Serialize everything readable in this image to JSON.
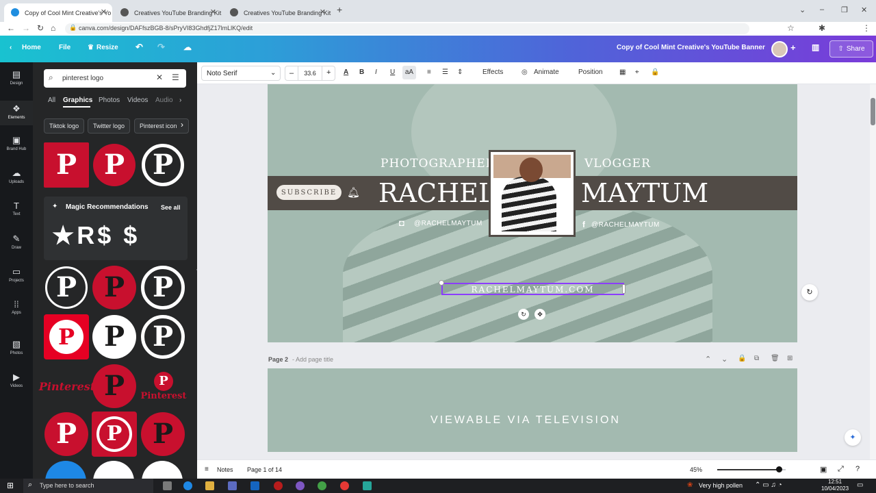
{
  "browser": {
    "tabs": [
      {
        "title": "Copy of Cool Mint Creative's Yo",
        "active": true
      },
      {
        "title": "Creatives YouTube Branding Kit",
        "active": false
      },
      {
        "title": "Creatives YouTube Branding Kit",
        "active": false
      }
    ],
    "url": "canva.com/design/DAFfszBGB-8/sPryVI83GhdfjZ17lmLlKQ/edit"
  },
  "canva_header": {
    "home": "Home",
    "file": "File",
    "resize": "Resize",
    "doc_title": "Copy of Cool Mint Creative's YouTube Banner",
    "share": "Share"
  },
  "rail": [
    "Design",
    "Elements",
    "Brand Hub",
    "Uploads",
    "Text",
    "Draw",
    "Projects",
    "Apps",
    "Photos",
    "Videos"
  ],
  "panel": {
    "search_value": "pinterest logo",
    "tabs": [
      "All",
      "Graphics",
      "Photos",
      "Videos",
      "Audio"
    ],
    "chips": [
      "Tiktok logo",
      "Twitter logo",
      "Pinterest icon"
    ],
    "magic_title": "Magic Recommendations",
    "see_all": "See all",
    "magic_items": "★R$ $",
    "wordmark": "Pinterest",
    "pin_glyph": "P"
  },
  "toolbar": {
    "font": "Noto Serif",
    "size": "33.6",
    "effects": "Effects",
    "animate": "Animate",
    "position": "Position"
  },
  "design": {
    "photographer": "PHOTOGRAPHER",
    "vlogger": "VLOGGER",
    "subscribe": "SUBSCRIBE",
    "first_name": "RACHEL",
    "last_name": "MAYTUM",
    "instagram": "@RACHELMAYTUM",
    "facebook": "@RACHELMAYTUM",
    "website": "RACHELMAYTUM.COM",
    "page2_label": "Page 2",
    "page2_title_placeholder": "- Add page title",
    "page2_text": "VIEWABLE VIA TELEVISION"
  },
  "status": {
    "notes": "Notes",
    "page": "Page 1 of 14",
    "zoom": "45%",
    "zoom_level": 0.45
  },
  "taskbar": {
    "search": "Type here to search",
    "weather": "Very high pollen",
    "time": "12:51",
    "date": "10/04/2023"
  },
  "colors": {
    "pinterest_red": "#c8102e",
    "canvas_mint": "#a3bab0",
    "banner_dark": "#514b46"
  }
}
